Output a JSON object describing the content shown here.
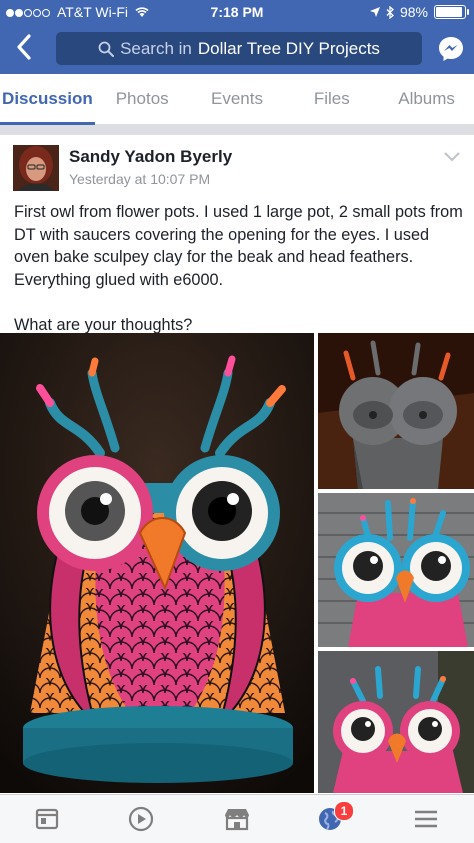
{
  "status_bar": {
    "carrier": "AT&T Wi-Fi",
    "time": "7:18 PM",
    "battery_percent": "98%"
  },
  "nav": {
    "search_prefix": "Search in",
    "group_name": "Dollar Tree DIY Projects"
  },
  "tabs": [
    {
      "label": "Discussion",
      "active": true
    },
    {
      "label": "Photos",
      "active": false
    },
    {
      "label": "Events",
      "active": false
    },
    {
      "label": "Files",
      "active": false
    },
    {
      "label": "Albums",
      "active": false
    }
  ],
  "post": {
    "author": "Sandy Yadon Byerly",
    "timestamp": "Yesterday at 10:07 PM",
    "text": "First owl from flower pots. I used 1 large pot, 2 small pots from DT with saucers covering the opening for the eyes. I used oven bake sculpey clay for the beak and head feathers. Everything glued with e6000.\n\nWhat are your thoughts?"
  },
  "bottom_nav": {
    "icons": [
      "news-feed-icon",
      "watch-icon",
      "marketplace-icon",
      "notifications-globe-icon",
      "menu-icon"
    ],
    "notification_count": "1"
  },
  "colors": {
    "brand": "#4267b2",
    "badge": "#fa3e3e"
  }
}
